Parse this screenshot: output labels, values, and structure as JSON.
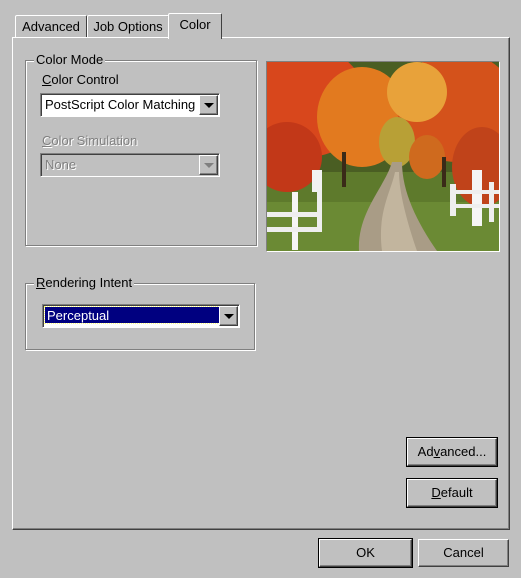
{
  "tabs": [
    {
      "label": "Advanced",
      "active": false
    },
    {
      "label": "Job Options",
      "active": false
    },
    {
      "label": "Color",
      "active": true
    }
  ],
  "color_mode": {
    "group_label": "Color Mode",
    "color_control": {
      "label_prefix": "",
      "label_mnemonic": "C",
      "label_rest": "olor Control",
      "value": "PostScript Color Matching"
    },
    "color_simulation": {
      "label_prefix": "",
      "label_mnemonic": "C",
      "label_rest": "olor Simulation",
      "value": "None",
      "enabled": false
    }
  },
  "rendering_intent": {
    "group_label_mnemonic": "R",
    "group_label_rest": "endering Intent",
    "value": "Perceptual"
  },
  "preview": {
    "description_icon": "autumn-road-preview-image"
  },
  "buttons": {
    "advanced": {
      "prefix": "Ad",
      "mnemonic": "v",
      "rest": "anced..."
    },
    "default": {
      "prefix": "",
      "mnemonic": "D",
      "rest": "efault"
    },
    "ok": {
      "prefix": "",
      "mnemonic": "",
      "rest": "OK"
    },
    "cancel": {
      "prefix": "Cancel",
      "mnemonic": "",
      "rest": ""
    }
  },
  "colors": {
    "face": "#c0c0c0",
    "selection": "#000080",
    "disabled_text": "#808080"
  }
}
